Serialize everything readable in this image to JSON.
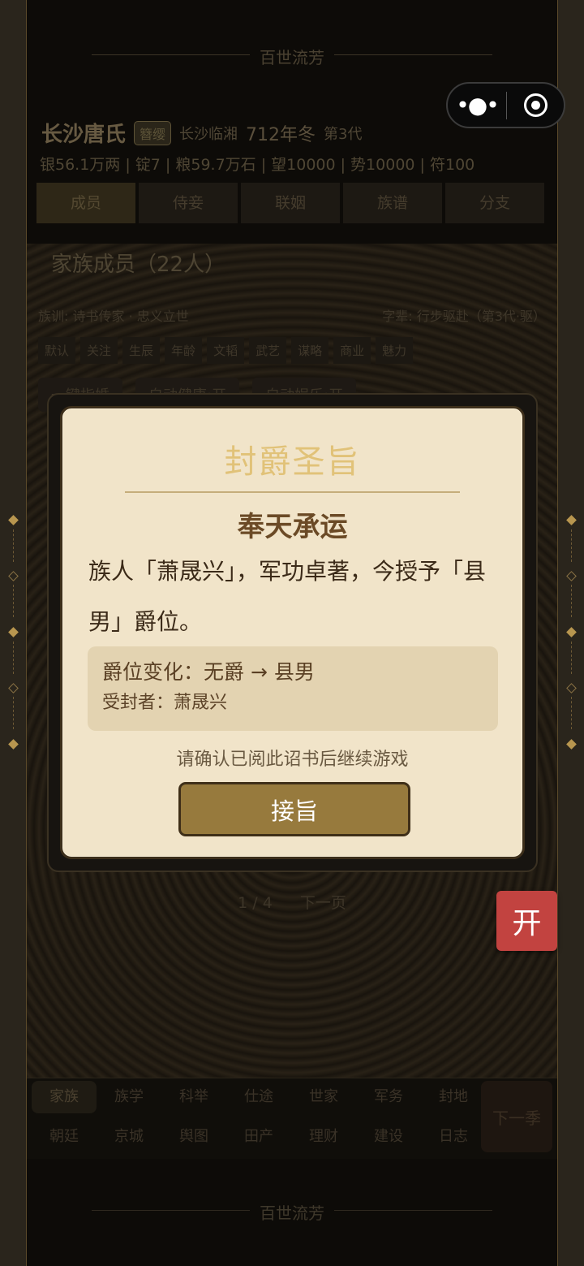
{
  "header": {
    "title": "百世流芳"
  },
  "capsule": {
    "more_icon": "more-dots-icon",
    "close_icon": "target-icon"
  },
  "family": {
    "name": "长沙唐氏",
    "badge": "簪缨",
    "location": "长沙临湘",
    "year": "712年冬",
    "generation": "第3代"
  },
  "resources": "银56.1万两 | 锭7 | 粮59.7万石 | 望10000 | 势10000 | 符100",
  "tabs": [
    "成员",
    "侍妾",
    "联姻",
    "族谱",
    "分支"
  ],
  "section": {
    "title": "家族成员（22人）"
  },
  "info": {
    "left": "族训: 诗书传家 · 忠义立世",
    "right": "字辈: 行步驱赴（第3代·驱）"
  },
  "sort_chips": [
    "默认",
    "关注",
    "生辰",
    "年龄",
    "文韬",
    "武艺",
    "谋略",
    "商业",
    "魅力"
  ],
  "action_buttons": [
    "一键指婚",
    "自动健康:开",
    "自动娱乐:开"
  ],
  "pager": {
    "page": "1 / 4",
    "next": "下一页"
  },
  "bottom_nav": {
    "row1": [
      "家族",
      "族学",
      "科举",
      "仕途",
      "世家",
      "军务",
      "封地"
    ],
    "row2": [
      "朝廷",
      "京城",
      "舆图",
      "田产",
      "理财",
      "建设",
      "日志"
    ],
    "next_season": "下一季"
  },
  "footer": {
    "title": "百世流芳"
  },
  "float_button": "开",
  "modal": {
    "title": "封爵圣旨",
    "subtitle": "奉天承运",
    "body": "族人「萧晟兴」，军功卓著，今授予「县男」爵位。",
    "change": "爵位变化：无爵 → 县男",
    "recipient": "受封者：萧晟兴",
    "hint": "请确认已阅此诏书后继续游戏",
    "accept": "接旨"
  },
  "colors": {
    "modal_bg": "#f1e4c9",
    "accent_gold": "#e1c278",
    "button": "#977a3d",
    "float_red": "#c24340"
  }
}
